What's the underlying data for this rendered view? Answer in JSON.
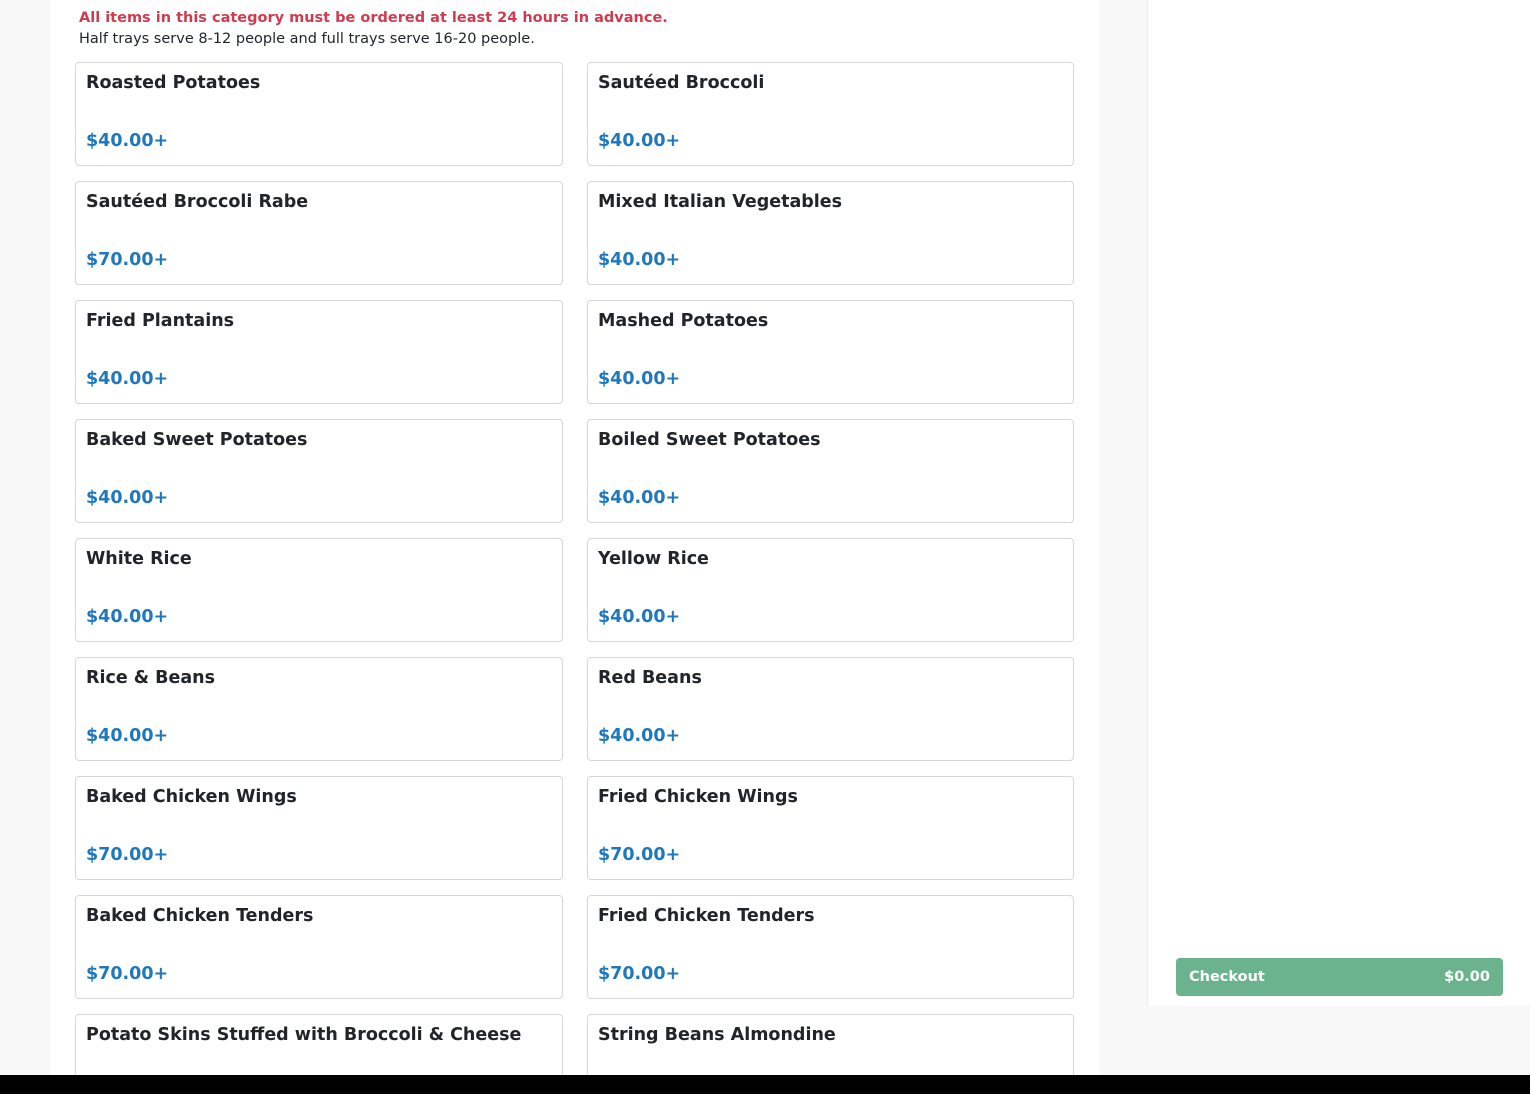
{
  "category": {
    "notice": "All items in this category must be ordered at least 24 hours in advance.",
    "serving_info": "Half trays serve 8-12 people and full trays serve 16-20 people."
  },
  "items": [
    {
      "name": "Roasted Potatoes",
      "price": "$40.00+"
    },
    {
      "name": "Sautéed Broccoli",
      "price": "$40.00+"
    },
    {
      "name": "Sautéed Broccoli Rabe",
      "price": "$70.00+"
    },
    {
      "name": "Mixed Italian Vegetables",
      "price": "$40.00+"
    },
    {
      "name": "Fried Plantains",
      "price": "$40.00+"
    },
    {
      "name": "Mashed Potatoes",
      "price": "$40.00+"
    },
    {
      "name": "Baked Sweet Potatoes",
      "price": "$40.00+"
    },
    {
      "name": "Boiled Sweet Potatoes",
      "price": "$40.00+"
    },
    {
      "name": "White Rice",
      "price": "$40.00+"
    },
    {
      "name": "Yellow Rice",
      "price": "$40.00+"
    },
    {
      "name": "Rice & Beans",
      "price": "$40.00+"
    },
    {
      "name": "Red Beans",
      "price": "$40.00+"
    },
    {
      "name": "Baked Chicken Wings",
      "price": "$70.00+"
    },
    {
      "name": "Fried Chicken Wings",
      "price": "$70.00+"
    },
    {
      "name": "Baked Chicken Tenders",
      "price": "$70.00+"
    },
    {
      "name": "Fried Chicken Tenders",
      "price": "$70.00+"
    },
    {
      "name": "Potato Skins Stuffed with Broccoli & Cheese",
      "price": ""
    },
    {
      "name": "String Beans Almondine",
      "price": ""
    }
  ],
  "cart": {
    "checkout_label": "Checkout",
    "total": "$0.00"
  },
  "colors": {
    "notice_red": "#cf3c4f",
    "price_blue": "#1f77be",
    "checkout_green": "#6bb38f"
  }
}
